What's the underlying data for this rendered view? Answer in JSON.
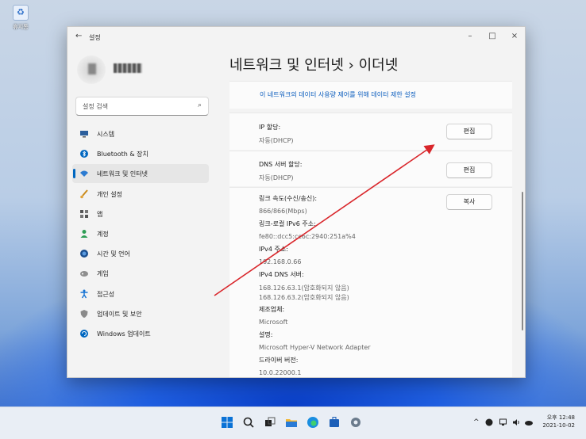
{
  "desktop": {
    "recycle_bin_label": "휴지통"
  },
  "window": {
    "back_icon": "←",
    "title": "설정",
    "controls": {
      "min": "–",
      "max": "□",
      "close": "×"
    }
  },
  "search": {
    "placeholder": "설정 검색",
    "icon": "⌕"
  },
  "nav": {
    "items": [
      {
        "label": "시스템",
        "icon": "monitor-icon"
      },
      {
        "label": "Bluetooth & 장치",
        "icon": "bluetooth-icon"
      },
      {
        "label": "네트워크 및 인터넷",
        "icon": "wifi-icon",
        "active": true
      },
      {
        "label": "개인 설정",
        "icon": "brush-icon"
      },
      {
        "label": "앱",
        "icon": "apps-icon"
      },
      {
        "label": "계정",
        "icon": "person-icon"
      },
      {
        "label": "시간 및 언어",
        "icon": "globe-clock-icon"
      },
      {
        "label": "게임",
        "icon": "gamepad-icon"
      },
      {
        "label": "접근성",
        "icon": "accessibility-icon"
      },
      {
        "label": "업데이트 및 보안",
        "icon": "shield-icon"
      },
      {
        "label": "Windows 업데이트",
        "icon": "windows-update-icon"
      }
    ]
  },
  "breadcrumb": {
    "parent": "네트워크 및 인터넷",
    "separator": "›",
    "current": "이더넷"
  },
  "content": {
    "metered_link": "이 네트워크의 데이터 사용량 제어를 위해 데이터 제한 설정",
    "ip": {
      "label": "IP 할당:",
      "value": "자동(DHCP)",
      "button": "편집"
    },
    "dns": {
      "label": "DNS 서버 할당:",
      "value": "자동(DHCP)",
      "button": "편집"
    },
    "props": {
      "button": "복사",
      "link_speed_label": "링크 속도(수신/송신):",
      "link_speed_value": "866/866(Mbps)",
      "ipv6_label": "링크-로컬 IPv6 주소:",
      "ipv6_value": "fe80::dcc5:cc6c:2940:251a%4",
      "ipv4_label": "IPv4 주소:",
      "ipv4_value": "192.168.0.66",
      "dns_label": "IPv4 DNS 서버:",
      "dns_value1": "168.126.63.1(암호화되지 않음)",
      "dns_value2": "168.126.63.2(암호화되지 않음)",
      "manufacturer_label": "제조업체:",
      "manufacturer_value": "Microsoft",
      "description_label": "설명:",
      "description_value": "Microsoft Hyper-V Network Adapter",
      "driver_label": "드라이버 버전:",
      "driver_value": "10.0.22000.1"
    }
  },
  "taskbar": {
    "icons": [
      "windows-start-icon",
      "search-icon",
      "task-view-icon",
      "file-explorer-icon",
      "edge-icon",
      "store-icon",
      "settings-icon"
    ],
    "tray_chevron": "^",
    "time": "오후 12:48",
    "date": "2021-10-02"
  },
  "colors": {
    "accent": "#0067c0",
    "arrow": "#d9262b",
    "link": "#0a5cbd"
  }
}
